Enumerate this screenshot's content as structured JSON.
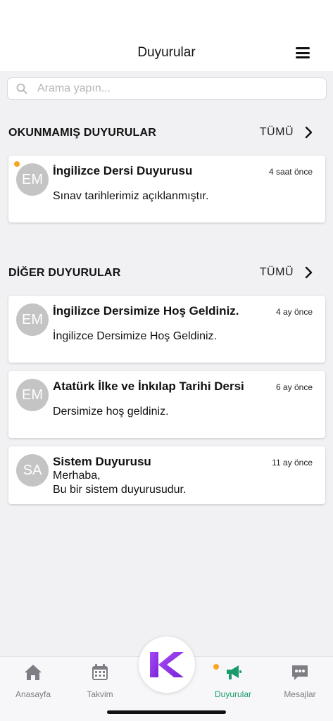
{
  "header": {
    "title": "Duyurular"
  },
  "search": {
    "placeholder": "Arama yapın..."
  },
  "unread": {
    "title": "OKUNMAMIŞ DUYURULAR",
    "see_all": "TÜMÜ",
    "items": [
      {
        "initials": "EM",
        "title": "İngilizce Dersi Duyurusu",
        "time": "4 saat önce",
        "body": "Sınav tarihlerimiz açıklanmıştır."
      }
    ]
  },
  "other": {
    "title": "DİĞER DUYURULAR",
    "see_all": "TÜMÜ",
    "items": [
      {
        "initials": "EM",
        "title": "İngilizce Dersimize Hoş Geldiniz.",
        "time": "4 ay önce",
        "body": "İngilizce Dersimize Hoş Geldiniz."
      },
      {
        "initials": "EM",
        "title": "Atatürk İlke ve İnkılap Tarihi Dersi",
        "time": "6 ay önce",
        "body": "Dersimize hoş geldiniz."
      },
      {
        "initials": "SA",
        "title": "Sistem Duyurusu",
        "time": "11 ay önce",
        "body_line1": "Merhaba,",
        "body_line2": "Bu bir sistem duyurusudur."
      }
    ]
  },
  "tabs": [
    {
      "label": "Anasayfa",
      "icon": "home-icon"
    },
    {
      "label": "Takvim",
      "icon": "calendar-icon"
    },
    {
      "label": "Duyurular",
      "icon": "megaphone-icon",
      "active": true
    },
    {
      "label": "Mesajlar",
      "icon": "chat-icon"
    }
  ],
  "colors": {
    "accent": "#1a9b6b",
    "unread_dot": "#f5a623",
    "logo": "#8a2be2",
    "avatar": "#c4c4c4"
  }
}
